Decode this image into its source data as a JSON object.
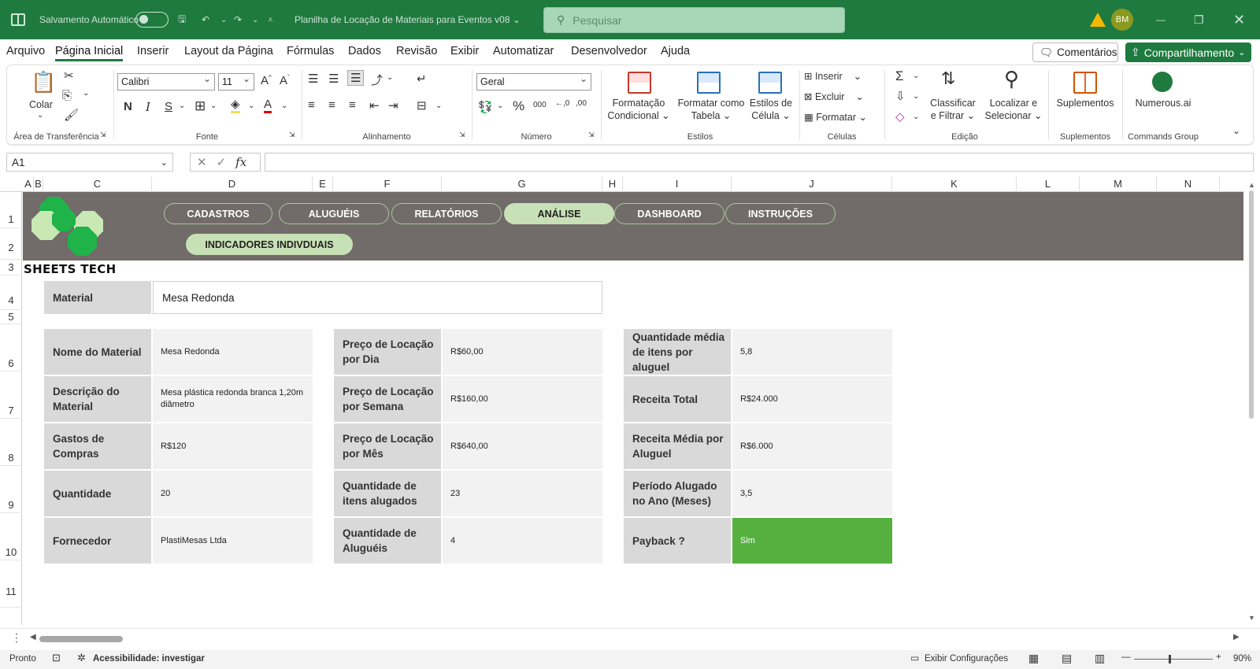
{
  "titlebar": {
    "autosave_label": "Salvamento Automático",
    "doc_title": "Planilha de Locação de Materiais para Eventos v08",
    "search_placeholder": "Pesquisar",
    "user_initials": "BM",
    "accent_color": "#1f7a3f"
  },
  "menu": {
    "tabs": [
      "Arquivo",
      "Página Inicial",
      "Inserir",
      "Layout da Página",
      "Fórmulas",
      "Dados",
      "Revisão",
      "Exibir",
      "Automatizar",
      "Desenvolvedor",
      "Ajuda"
    ],
    "active": "Página Inicial",
    "comments_label": "Comentários",
    "share_label": "Compartilhamento"
  },
  "ribbon": {
    "clipboard": {
      "paste_label": "Colar",
      "group_label": "Área de Transferência"
    },
    "font": {
      "font_name": "Calibri",
      "font_size": "11",
      "group_label": "Fonte"
    },
    "alignment": {
      "group_label": "Alinhamento"
    },
    "number": {
      "format": "Geral",
      "group_label": "Número"
    },
    "styles": {
      "conditional": [
        "Formatação",
        "Condicional"
      ],
      "table": [
        "Formatar como",
        "Tabela"
      ],
      "cell": [
        "Estilos de",
        "Célula"
      ],
      "group_label": "Estilos"
    },
    "cells": {
      "insert": "Inserir",
      "delete": "Excluir",
      "format": "Formatar",
      "group_label": "Células"
    },
    "editing": {
      "sort": [
        "Classificar",
        "e Filtrar"
      ],
      "find": [
        "Localizar e",
        "Selecionar"
      ],
      "group_label": "Edição"
    },
    "addins": {
      "label": "Suplementos",
      "group_label": "Suplementos"
    },
    "commands": {
      "label": "Numerous.ai",
      "group_label": "Commands Group"
    }
  },
  "formula_bar": {
    "name_box": "A1",
    "formula": ""
  },
  "columns": [
    "A",
    "B",
    "C",
    "D",
    "E",
    "F",
    "G",
    "H",
    "I",
    "J",
    "K",
    "L",
    "M",
    "N"
  ],
  "rows": [
    "1",
    "2",
    "3",
    "4",
    "5",
    "6",
    "7",
    "8",
    "9",
    "10",
    "11"
  ],
  "sheet": {
    "nav_buttons": [
      "CADASTROS",
      "ALUGUÉIS",
      "RELATÓRIOS",
      "ANÁLISE",
      "DASHBOARD",
      "INSTRUÇÕES"
    ],
    "active_nav": "ANÁLISE",
    "sub_button": "INDICADORES INDIVDUAIS",
    "logo_text": "SHEETS TECH",
    "material_label": "Material",
    "material_value": "Mesa Redonda",
    "col1": [
      {
        "label": "Nome do Material",
        "value": "Mesa Redonda"
      },
      {
        "label": "Descrição do Material",
        "value": "Mesa plástica redonda branca 1,20m diâmetro"
      },
      {
        "label": "Gastos de Compras",
        "value": "R$120"
      },
      {
        "label": "Quantidade",
        "value": "20"
      },
      {
        "label": "Fornecedor",
        "value": "PlastiMesas Ltda"
      }
    ],
    "col2": [
      {
        "label": "Preço de Locação por Dia",
        "value": "R$60,00"
      },
      {
        "label": "Preço de Locação por Semana",
        "value": "R$160,00"
      },
      {
        "label": "Preço de Locação por Mês",
        "value": "R$640,00"
      },
      {
        "label": "Quantidade de itens alugados",
        "value": "23"
      },
      {
        "label": "Quantidade de Aluguéis",
        "value": "4"
      }
    ],
    "col3": [
      {
        "label": "Quantidade média de itens por aluguel",
        "value": "5,8"
      },
      {
        "label": "Receita Total",
        "value": "R$24.000"
      },
      {
        "label": "Receita Média por Aluguel",
        "value": "R$6.000"
      },
      {
        "label": "Período Alugado no Ano (Meses)",
        "value": "3,5"
      },
      {
        "label": "Payback ?",
        "value": "Sim"
      }
    ],
    "payback_color": "#55b03f",
    "banner_color": "#716b6a"
  },
  "status": {
    "ready": "Pronto",
    "accessibility": "Acessibilidade: investigar",
    "display_settings": "Exibir Configurações",
    "zoom": "90%"
  }
}
